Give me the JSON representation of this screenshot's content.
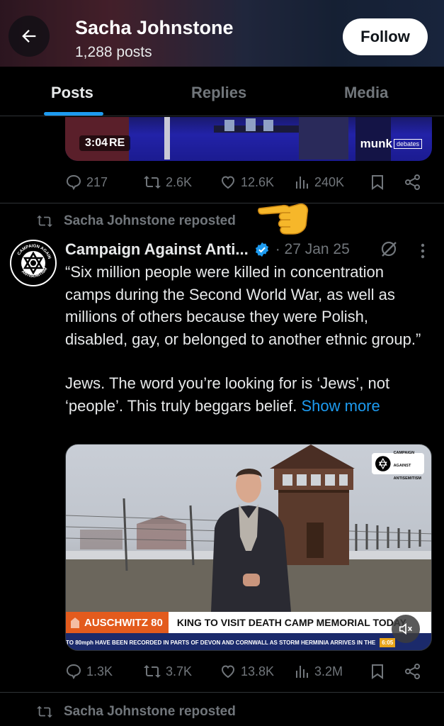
{
  "header": {
    "name": "Sacha Johnstone",
    "posts_count": "1,288 posts",
    "follow_label": "Follow"
  },
  "tabs": [
    {
      "label": "Posts",
      "active": true
    },
    {
      "label": "Replies",
      "active": false
    },
    {
      "label": "Media",
      "active": false
    }
  ],
  "top_post": {
    "video_time": "3:04",
    "video_watermark": "RE",
    "munk_logo": "munk",
    "munk_logo_box": "debates",
    "actions": {
      "replies": "217",
      "reposts": "2.6K",
      "likes": "12.6K",
      "views": "240K"
    }
  },
  "repost_label": "Sacha Johnstone reposted",
  "tweet": {
    "author": "Campaign Against Anti...",
    "date": "· 27 Jan 25",
    "paragraph1": "“Six million people were killed in concentration camps during the Second World War, as well as millions of others because they were Polish, disabled, gay, or belonged to another ethnic group.”",
    "paragraph2": "Jews. The word you’re looking for is ‘Jews’, not ‘people’. This truly beggars belief.",
    "show_more": "Show more",
    "avatar_text_top": "CAMPAIGN AGAINST",
    "avatar_text_bottom": "ANTISEMITISM",
    "media": {
      "badge_line1": "CAMPAIGN",
      "badge_line2": "AGAINST",
      "badge_line3": "ANTISEMITISM",
      "banner_label": "AUSCHWITZ 80",
      "banner_headline": "KING TO VISIT DEATH CAMP MEMORIAL TODAY",
      "ticker": "TO 80mph HAVE BEEN RECORDED IN PARTS OF DEVON AND CORNWALL AS STORM HERMINIA ARRIVES IN THE",
      "clock": "6:05"
    },
    "actions": {
      "replies": "1.3K",
      "reposts": "3.7K",
      "likes": "13.8K",
      "views": "3.2M"
    }
  },
  "next_repost_label": "Sacha Johnstone reposted",
  "colors": {
    "accent": "#1d9bf0",
    "muted": "#71767b",
    "text": "#e7e9ea",
    "banner_orange": "#e35b1d",
    "ticker_blue": "#1b2a6b"
  }
}
